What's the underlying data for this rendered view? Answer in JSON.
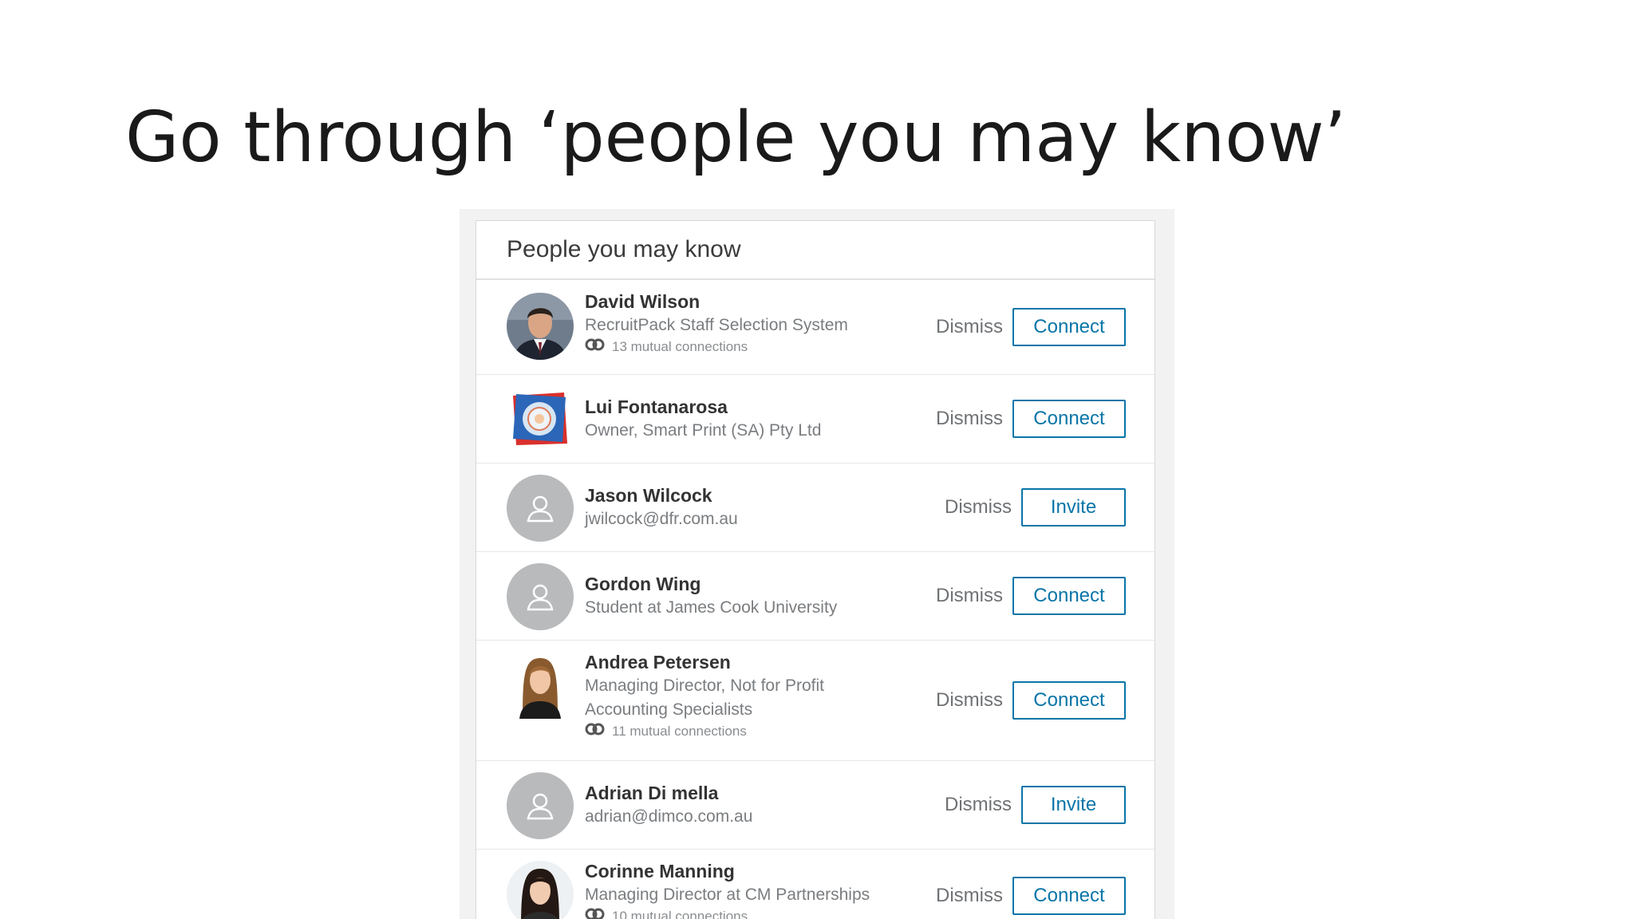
{
  "slide": {
    "title": "Go through ‘people you may know’"
  },
  "panel": {
    "header": "People you may know",
    "dismiss_label": "Dismiss",
    "people": [
      {
        "name": "David Wilson",
        "subtitle": "RecruitPack Staff Selection System",
        "mutual": "13 mutual connections",
        "action": "Connect",
        "avatar": "photo-man"
      },
      {
        "name": "Lui Fontanarosa",
        "subtitle": "Owner, Smart Print (SA) Pty Ltd",
        "action": "Connect",
        "avatar": "company-logo"
      },
      {
        "name": "Jason Wilcock",
        "subtitle": "jwilcock@dfr.com.au",
        "action": "Invite",
        "avatar": "placeholder-person-icon"
      },
      {
        "name": "Gordon Wing",
        "subtitle": "Student at James Cook University",
        "action": "Connect",
        "avatar": "placeholder-person-icon"
      },
      {
        "name": "Andrea Petersen",
        "subtitle": "Managing Director, Not for Profit",
        "subtitle2": "Accounting Specialists",
        "mutual": "11 mutual connections",
        "action": "Connect",
        "avatar": "photo-woman"
      },
      {
        "name": "Adrian Di mella",
        "subtitle": "adrian@dimco.com.au",
        "action": "Invite",
        "avatar": "placeholder-person-icon"
      },
      {
        "name": "Corinne Manning",
        "subtitle": "Managing Director at CM Partnerships",
        "mutual": "10 mutual connections",
        "action": "Connect",
        "avatar": "photo-woman"
      }
    ]
  },
  "colors": {
    "accent": "#0a75a8",
    "placeholder_avatar": "#b8babc",
    "name_text": "#333333",
    "muted_text": "#7a7d80"
  }
}
